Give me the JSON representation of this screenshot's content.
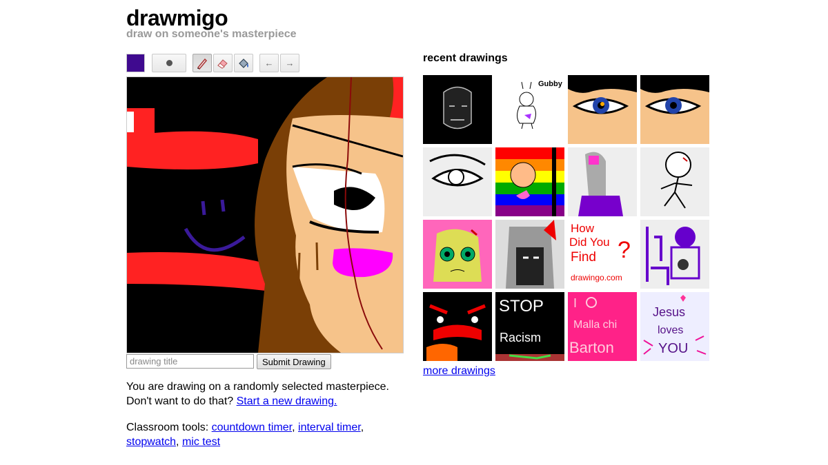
{
  "header": {
    "title": "drawmigo",
    "subtitle": "draw on someone's masterpiece"
  },
  "toolbar": {
    "current_color": "#3f0a8f",
    "brush_size_icon": "dot-icon",
    "tools": [
      "pencil-icon",
      "eraser-icon",
      "fill-bucket-icon"
    ],
    "undo_label": "←",
    "redo_label": "→"
  },
  "form": {
    "title_placeholder": "drawing title",
    "submit_label": "Submit Drawing"
  },
  "info": {
    "line1": "You are drawing on a randomly selected masterpiece.",
    "line2_prefix": "Don't want to do that?",
    "line2_link": "Start a new drawing."
  },
  "classroom": {
    "prefix": "Classroom tools:",
    "links": [
      "countdown timer",
      "interval timer",
      "stopwatch",
      "mic test"
    ]
  },
  "recent": {
    "heading": "recent drawings",
    "more_link": "more drawings",
    "thumb_texts": {
      "gubby": "Gubby",
      "howdid": [
        "How",
        "Did You",
        "Find",
        "?",
        "drawingo.com"
      ],
      "stop": [
        "STOP",
        "Racism"
      ],
      "malla": [
        "I",
        "Malla chi",
        "Barton"
      ],
      "jesus": [
        "Jesus",
        "loves",
        "YOU"
      ]
    }
  }
}
